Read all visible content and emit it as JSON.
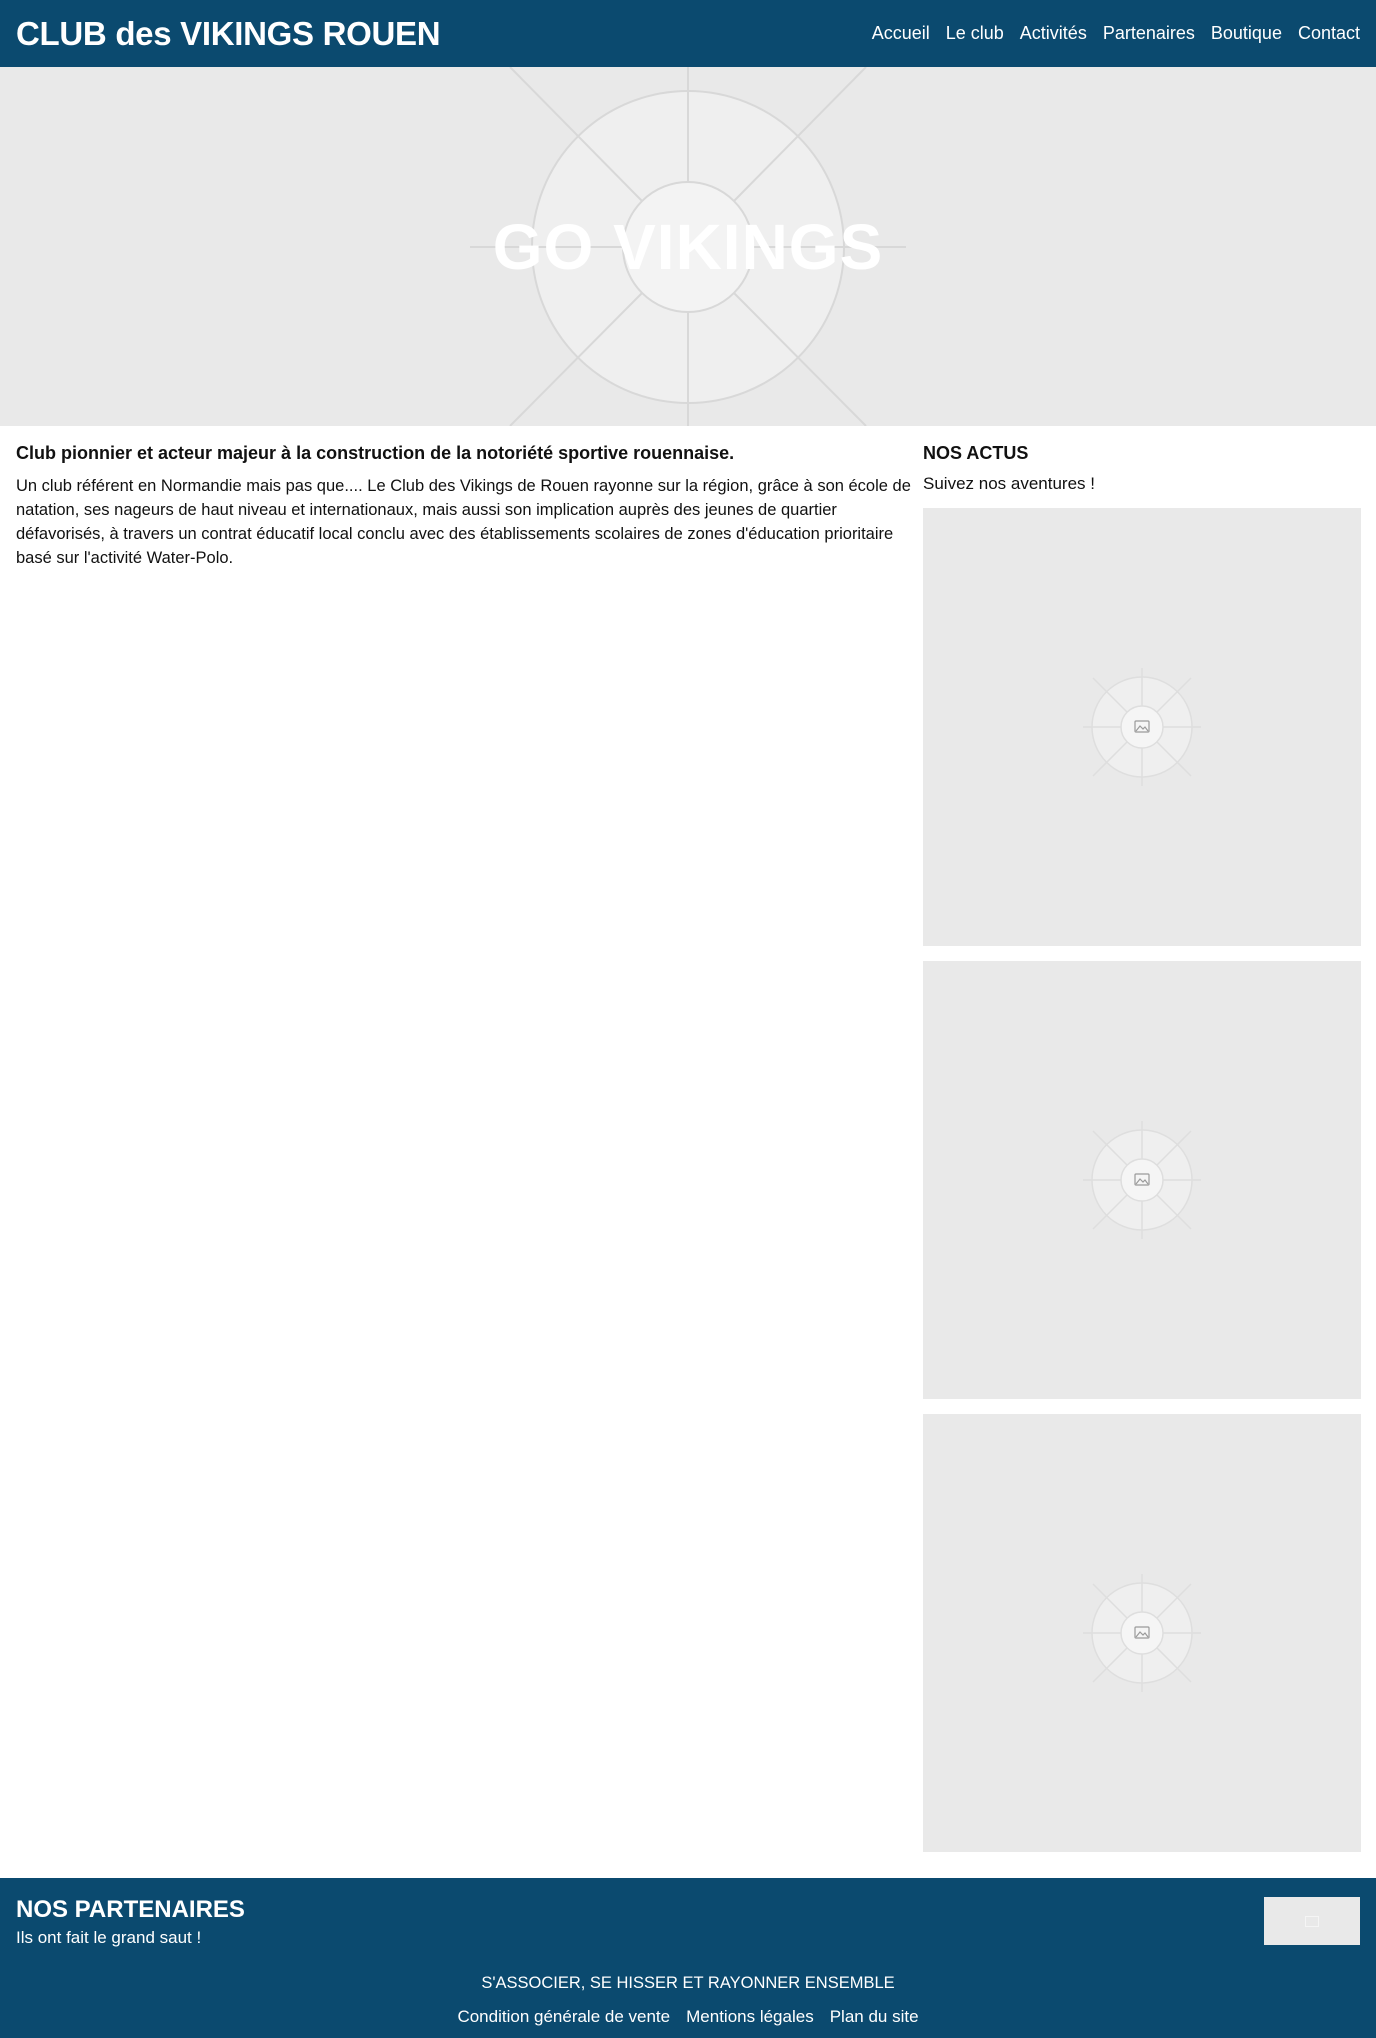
{
  "header": {
    "brand": "CLUB des VIKINGS ROUEN",
    "nav": [
      "Accueil",
      "Le club",
      "Activités",
      "Partenaires",
      "Boutique",
      "Contact"
    ]
  },
  "hero": {
    "title": "GO VIKINGS",
    "image_icon": "image-placeholder-icon"
  },
  "intro": {
    "heading": "Club pionnier et acteur majeur à la construction de la notoriété sportive rouennaise.",
    "body": "Un club référent en Normandie mais pas que.... Le Club des Vikings de Rouen rayonne sur la région, grâce à son école de natation, ses nageurs de haut niveau et internationaux, mais aussi son implication auprès des jeunes de quartier défavorisés, à travers un contrat éducatif local conclu avec des établissements scolaires de zones d'éducation prioritaire basé sur l'activité Water-Polo."
  },
  "news": {
    "heading": "NOS ACTUS",
    "subtitle": "Suivez nos aventures !",
    "cards_icon": "image-placeholder-icon"
  },
  "footer": {
    "partners_title": "NOS PARTENAIRES",
    "partners_subtitle": "Ils ont fait le grand saut !",
    "tagline": "S'ASSOCIER, SE HISSER ET RAYONNER ENSEMBLE",
    "links": [
      "Condition générale de vente",
      "Mentions légales",
      "Plan du site"
    ]
  },
  "colors": {
    "primary": "#0b4a6f",
    "placeholder_bg": "#e9e9e9",
    "text": "#111111"
  }
}
